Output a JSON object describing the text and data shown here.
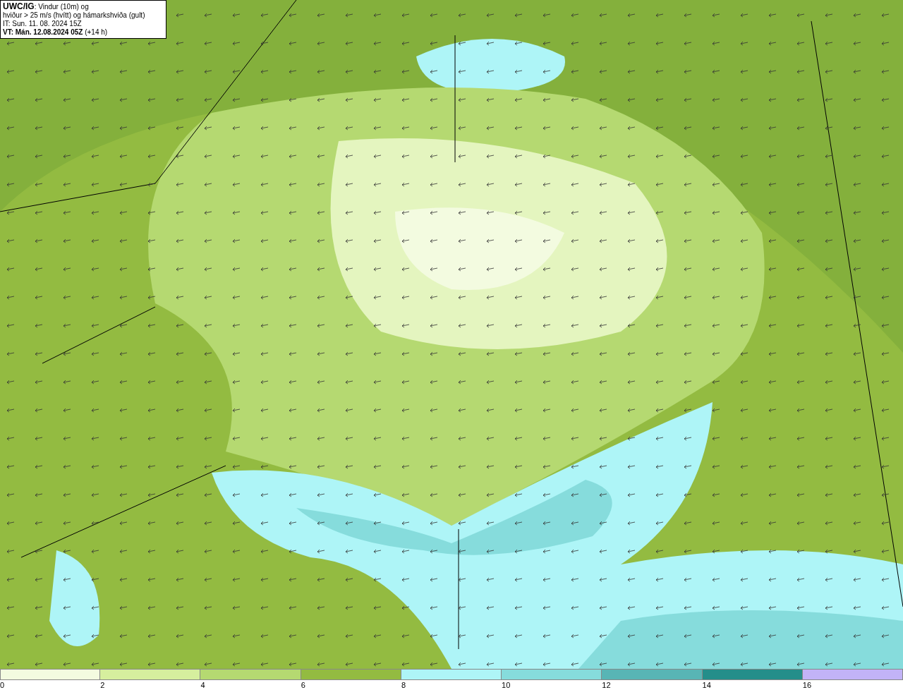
{
  "title_box": {
    "model": "UWC/IG",
    "heading_rest": ": Vindur (10m) og",
    "line_2": "hviður > 25 m/s (hvítt) og hámarkshviða (gult)",
    "issue_time": "IT: Sun. 11. 08. 2024 15Z",
    "valid_time": "VT: Mán. 12.08.2024 05Z",
    "lead_time": "(+14 h)"
  },
  "legend": {
    "bins": [
      {
        "color": "#f3fbe0",
        "label": "0"
      },
      {
        "color": "#d6ef9e",
        "label": "2"
      },
      {
        "color": "#b5d971",
        "label": "4"
      },
      {
        "color": "#93bb41",
        "label": "6"
      },
      {
        "color": "#aef5f7",
        "label": "8"
      },
      {
        "color": "#86dcdc",
        "label": "10"
      },
      {
        "color": "#58b5b5",
        "label": "12"
      },
      {
        "color": "#248e8a",
        "label": "14"
      },
      {
        "color": "#c2b3f7",
        "label": "16"
      }
    ]
  }
}
